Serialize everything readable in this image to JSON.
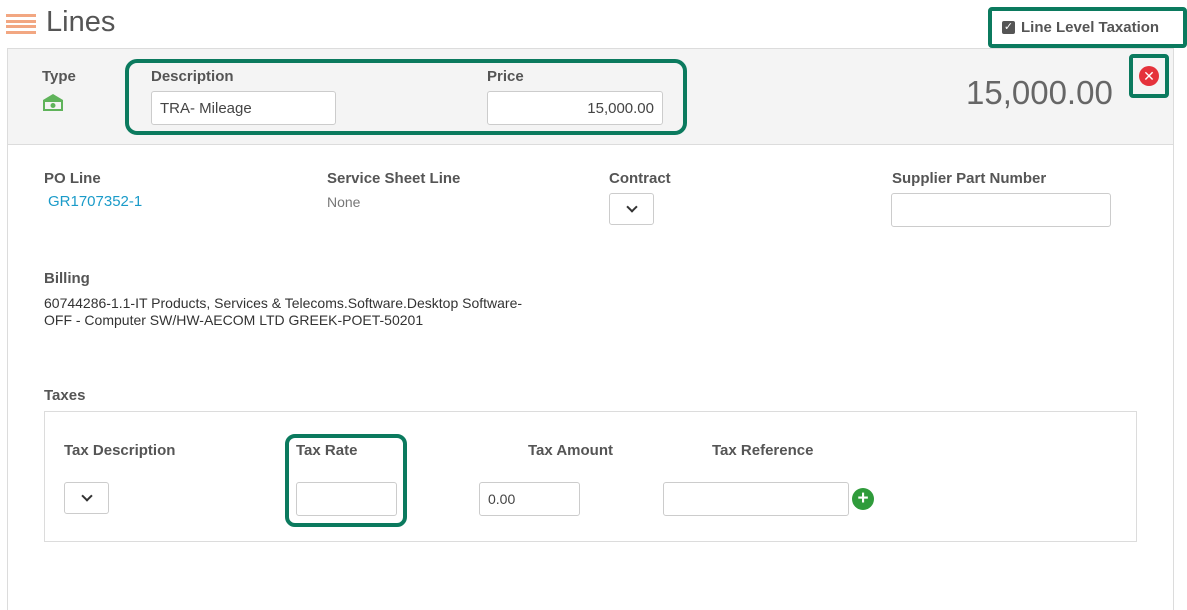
{
  "header": {
    "title": "Lines",
    "line_level_taxation": {
      "label": "Line Level Taxation",
      "checked": true
    }
  },
  "line": {
    "type_label": "Type",
    "type_icon": "money-icon",
    "description": {
      "label": "Description",
      "value": "TRA- Mileage"
    },
    "price": {
      "label": "Price",
      "value": "15,000.00"
    },
    "total": "15,000.00",
    "po_line": {
      "label": "PO Line",
      "value": "GR1707352-1"
    },
    "service_sheet_line": {
      "label": "Service Sheet Line",
      "value": "None"
    },
    "contract": {
      "label": "Contract"
    },
    "supplier_part_number": {
      "label": "Supplier Part Number",
      "value": ""
    },
    "billing": {
      "label": "Billing",
      "line1": "60744286-1.1-IT Products, Services & Telecoms.Software.Desktop Software-",
      "line2": "OFF - Computer SW/HW-AECOM LTD GREEK-POET-50201"
    }
  },
  "taxes": {
    "label": "Taxes",
    "columns": {
      "description": "Tax Description",
      "rate": "Tax Rate",
      "amount": "Tax Amount",
      "reference": "Tax Reference"
    },
    "row": {
      "rate": "",
      "amount": "0.00",
      "reference": ""
    }
  },
  "colors": {
    "highlight": "#0b7a5e",
    "link": "#1a9bc9",
    "delete": "#e5323b",
    "add": "#2f9b3b"
  }
}
